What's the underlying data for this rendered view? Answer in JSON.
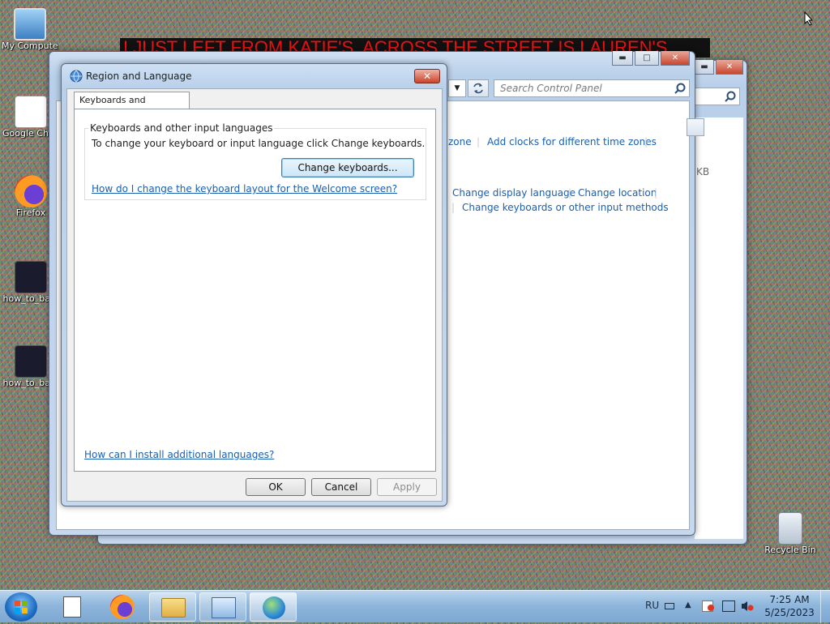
{
  "banner": {
    "text": "I JUST LEFT FROM KATIE'S, ACROSS THE STREET IS LAUREN'S"
  },
  "desktop": {
    "icons": [
      {
        "label": "My Computer"
      },
      {
        "label": "Google Chrome"
      },
      {
        "label": "Firefox"
      },
      {
        "label": "how_to_ba..."
      },
      {
        "label": "how_to_ba..."
      }
    ],
    "recycle_bin": {
      "label": "Recycle Bin"
    }
  },
  "control_panel": {
    "search_placeholder": "Search Control Panel",
    "links": {
      "zone": "zone",
      "add_clocks": "Add clocks for different time zones",
      "change_display_language": "Change display language",
      "change_location": "Change location",
      "change_keyboards": "Change keyboards or other input methods"
    },
    "kb": "KB"
  },
  "dialog": {
    "title": "Region and Language",
    "tab": "Keyboards and Languages",
    "group_title": "Keyboards and other input languages",
    "description": "To change your keyboard or input language click Change keyboards.",
    "change_keyboards_button": "Change keyboards...",
    "welcome_link": "How do I change the keyboard layout for the Welcome screen?",
    "install_link": "How can I install additional languages?",
    "ok": "OK",
    "cancel": "Cancel",
    "apply": "Apply"
  },
  "taskbar": {
    "language": "RU",
    "time": "7:25 AM",
    "date": "5/25/2023"
  },
  "colors": {
    "link": "#1a5fb0",
    "banner_text": "#e11"
  }
}
